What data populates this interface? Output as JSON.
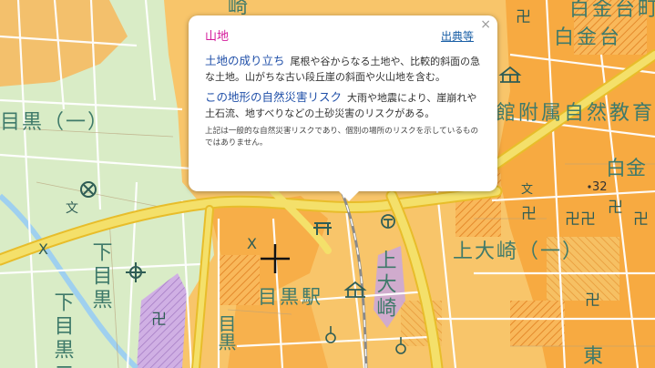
{
  "popup": {
    "landform_name": "山地",
    "source_link": "出典等",
    "close_glyph": "×",
    "formation_heading": "土地の成り立ち",
    "formation_text": "尾根や谷からなる土地や、比較的斜面の急な土地。山がちな古い段丘崖の斜面や火山地を含む。",
    "risk_heading": "この地形の自然災害リスク",
    "risk_text": "大雨や地震により、崖崩れや土石流、地すべりなどの土砂災害のリスクがある。",
    "note": "上記は一般的な自然災害リスクであり、個別の場所のリスクを示しているものではありません。"
  },
  "map_labels": {
    "meguro_1": "目黒（一）",
    "shimomeguro_1": "下目黒",
    "shimomeguro_2": "下目黒二",
    "meguro_station": "目黒駅",
    "kamiosaki_1": "上大崎（一）",
    "kamiosaki_2": "上大崎",
    "shirokanedai": "白金台",
    "shirokanedai_1": "白金台町",
    "shirokane_2": "白金",
    "museum": "館附属自然教育",
    "top_fragment": "崎",
    "higashi": "東",
    "elevation": "32"
  },
  "colors": {
    "lowland": "#d9ecc6",
    "terrace": "#f8c56a",
    "mountain": "#f7a43a",
    "hatch": "#e9a04b",
    "purple": "#c9a6de",
    "road_major": "#f2d64a",
    "road_minor": "#ffffff",
    "label": "#3f7a6a"
  },
  "icons": [
    "temple-icon",
    "police-box-icon",
    "shrine-icon",
    "post-office-icon",
    "factory-icon",
    "crosshair-icon",
    "station-icon",
    "museum-icon",
    "elevation-point-icon"
  ]
}
